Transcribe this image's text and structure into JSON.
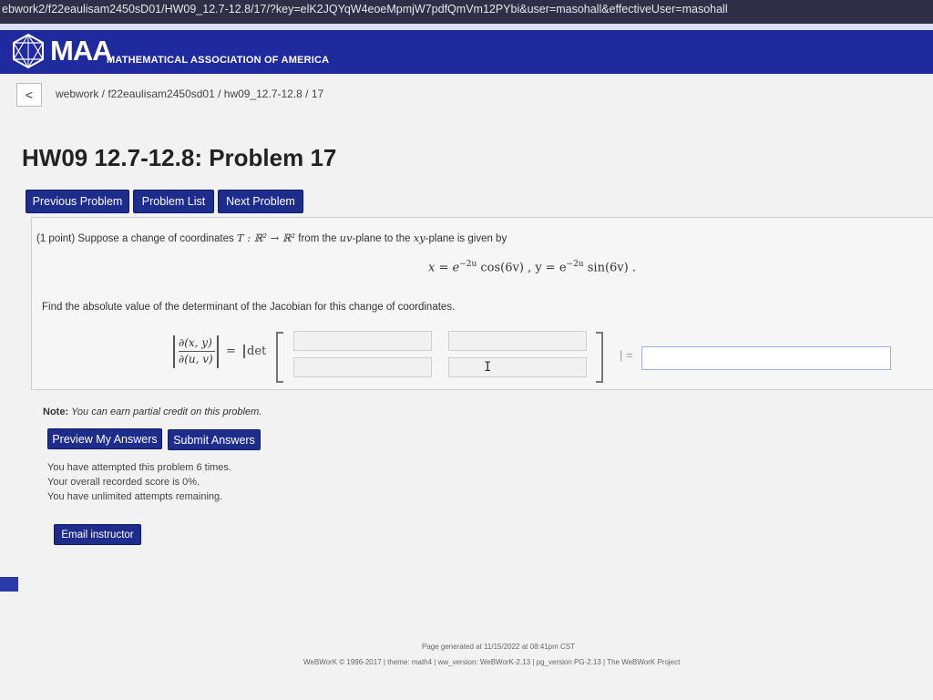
{
  "browser": {
    "url": "ebwork2/f22eaulisam2450sD01/HW09_12.7-12.8/17/?key=elK2JQYqW4eoeMpmjW7pdfQmVm12PYbi&user=masohall&effectiveUser=masohall"
  },
  "header": {
    "logo_text": "MAA",
    "logo_subtitle": "MATHEMATICAL ASSOCIATION OF AMERICA"
  },
  "breadcrumb": {
    "back_label": "<",
    "path": "webwork / f22eaulisam2450sd01 / hw09_12.7-12.8 / 17"
  },
  "page": {
    "title": "HW09 12.7-12.8: Problem 17"
  },
  "nav_buttons": {
    "previous": "Previous Problem",
    "list": "Problem List",
    "next": "Next Problem"
  },
  "problem": {
    "points": "(1 point)",
    "statement_a": "Suppose a change of coordinates ",
    "statement_math1": "T : ℝ² → ℝ²",
    "statement_b": " from the ",
    "statement_math2": "uv",
    "statement_c": "-plane to the ",
    "statement_math3": "xy",
    "statement_d": "-plane is given by",
    "equation": "x = e^{-2u} cos(6v) ,   y = e^{-2u} sin(6v) .",
    "eq_x": "x = e",
    "eq_x_exp": "2u",
    "eq_x_rest": " cos(6v) ,   y = e",
    "eq_y_exp": "2u",
    "eq_y_rest": " sin(6v) .",
    "find_text": "Find the absolute value of the determinant of the Jacobian for this change of coordinates.",
    "jacobian_num": "∂(x, y)",
    "jacobian_den": "∂(u, v)",
    "equals": "=",
    "det_label": "det",
    "equals2": "| =",
    "note_label": "Note:",
    "note_text": "You can earn partial credit on this problem."
  },
  "submit_buttons": {
    "preview": "Preview My Answers",
    "submit": "Submit Answers"
  },
  "status": {
    "line1": "You have attempted this problem 6 times.",
    "line2": "Your overall recorded score is 0%.",
    "line3": "You have unlimited attempts remaining."
  },
  "email_button": "Email instructor",
  "footer": {
    "generated": "Page generated at 11/15/2022 at 08:41pm CST",
    "credits": "WeBWorK © 1996-2017 | theme: math4 | ww_version: WeBWorK-2.13 | pg_version PG-2.13 | The WeBWorK Project"
  },
  "colors": {
    "banner": "#1f2a9e",
    "button": "#1e2d8c",
    "urlbar": "#2f2f47"
  },
  "icons": [
    "maa-logo-icon",
    "chevron-left-icon",
    "text-cursor-icon"
  ]
}
